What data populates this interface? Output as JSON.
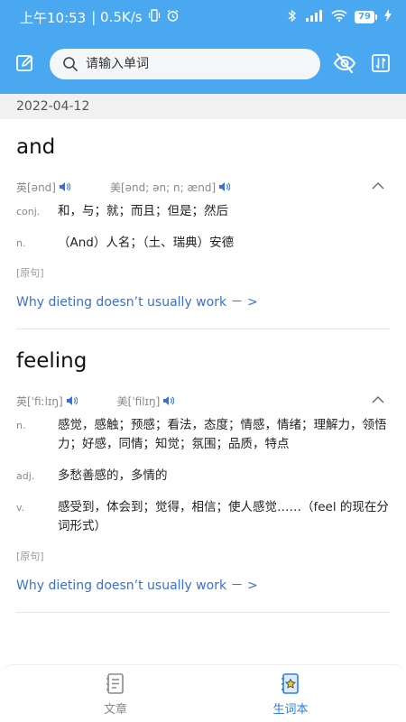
{
  "status_bar": {
    "time": "上午10:53",
    "speed": "| 0.5K/s",
    "battery": "79"
  },
  "search": {
    "placeholder": "请输入单词"
  },
  "date": "2022-04-12",
  "entries": [
    {
      "word": "and",
      "phon_uk": "英[ənd]",
      "phon_us": "美[ənd; ən; n; ænd]",
      "defs": [
        {
          "pos": "conj.",
          "text": "和，与；就；而且；但是；然后"
        },
        {
          "pos": "n.",
          "text": "（And）人名；（土、瑞典）安德"
        }
      ],
      "orig_label": "[原句]",
      "orig_sentence": "Why dieting doesn’t usually work －  >"
    },
    {
      "word": "feeling",
      "phon_uk": "英[ˈfiːlɪŋ]",
      "phon_us": "美[ˈfilɪŋ]",
      "defs": [
        {
          "pos": "n.",
          "text": "感觉，感触；预感；看法，态度；情感，情绪；理解力，领悟力；好感，同情；知觉；氛围；品质，特点"
        },
        {
          "pos": "adj.",
          "text": "多愁善感的，多情的"
        },
        {
          "pos": "v.",
          "text": "感受到，体会到；觉得，相信；使人感觉……（feel 的现在分词形式）"
        }
      ],
      "orig_label": "[原句]",
      "orig_sentence": "Why dieting doesn’t usually work －  >"
    }
  ],
  "tabs": [
    {
      "label": "文章"
    },
    {
      "label": "生词本"
    }
  ],
  "colors": {
    "accent": "#4aa8f0",
    "link": "#3a6fd8",
    "tab_active": "#2f7fe0",
    "tab_inactive": "#888888"
  }
}
